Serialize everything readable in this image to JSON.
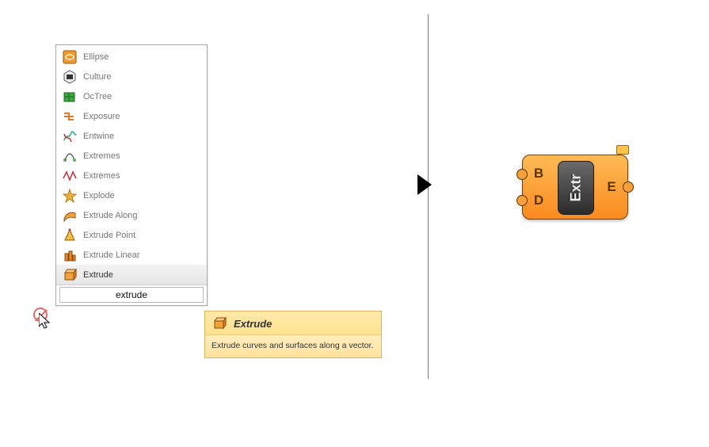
{
  "search": {
    "value": "extrude"
  },
  "items": [
    {
      "label": "Ellipse"
    },
    {
      "label": "Culture"
    },
    {
      "label": "OcTree"
    },
    {
      "label": "Exposure"
    },
    {
      "label": "Entwine"
    },
    {
      "label": "Extremes"
    },
    {
      "label": "Extremes"
    },
    {
      "label": "Explode"
    },
    {
      "label": "Extrude Along"
    },
    {
      "label": "Extrude Point"
    },
    {
      "label": "Extrude Linear"
    },
    {
      "label": "Extrude"
    }
  ],
  "tooltip": {
    "title": "Extrude",
    "body": "Extrude curves and surfaces along a vector."
  },
  "node": {
    "label": "Extr",
    "inputs": [
      "B",
      "D"
    ],
    "outputs": [
      "E"
    ]
  }
}
